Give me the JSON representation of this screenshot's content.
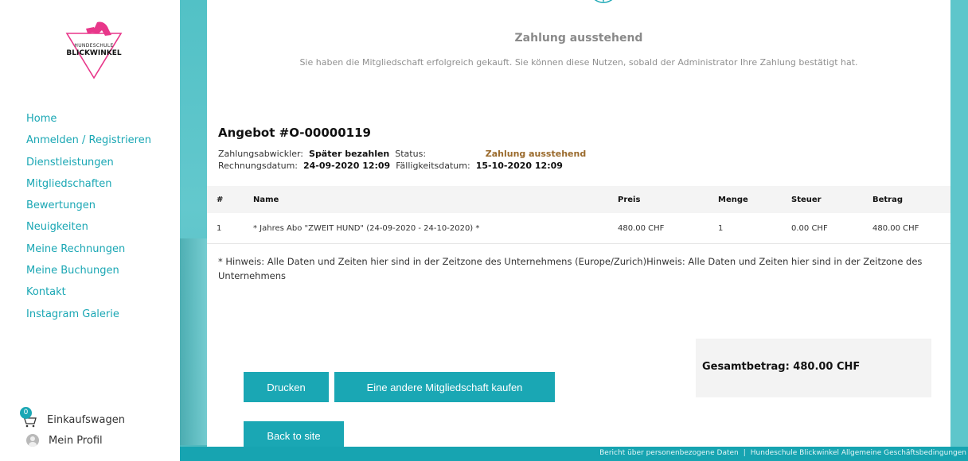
{
  "brand": {
    "line1": "HUNDESCHULE",
    "line2": "BLICKWINKEL",
    "accent": "#e8378a"
  },
  "sidebar": {
    "items": [
      {
        "label": "Home"
      },
      {
        "label": "Anmelden / Registrieren"
      },
      {
        "label": "Dienstleistungen"
      },
      {
        "label": "Mitgliedschaften"
      },
      {
        "label": "Bewertungen"
      },
      {
        "label": "Neuigkeiten"
      },
      {
        "label": "Meine Rechnungen"
      },
      {
        "label": "Meine Buchungen"
      },
      {
        "label": "Kontakt"
      },
      {
        "label": "Instagram Galerie"
      }
    ],
    "cart": {
      "label": "Einkaufswagen",
      "count": "0"
    },
    "profile": {
      "label": "Mein Profil"
    }
  },
  "status": {
    "title": "Zahlung ausstehend",
    "message": "Sie haben die Mitgliedschaft erfolgreich gekauft. Sie können diese Nutzen, sobald der Administrator Ihre Zahlung bestätigt hat."
  },
  "offer": {
    "title": "Angebot #O-00000119",
    "processor_label": "Zahlungsabwickler:",
    "processor_value": "Später bezahlen",
    "status_label": "Status:",
    "status_value": "Zahlung ausstehend",
    "invoice_date_label": "Rechnungsdatum:",
    "invoice_date_value": "24-09-2020 12:09",
    "due_date_label": "Fälligkeitsdatum:",
    "due_date_value": "15-10-2020 12:09"
  },
  "table": {
    "headers": [
      "#",
      "Name",
      "Preis",
      "Menge",
      "Steuer",
      "Betrag"
    ],
    "rows": [
      [
        "1",
        "* Jahres Abo \"ZWEIT HUND\" (24-09-2020 - 24-10-2020) *",
        "480.00 CHF",
        "1",
        "0.00 CHF",
        "480.00 CHF"
      ]
    ]
  },
  "note": "* Hinweis: Alle Daten und Zeiten hier sind in der Zeitzone des Unternehmens (Europe/Zurich)Hinweis: Alle Daten und Zeiten hier sind in der Zeitzone des Unternehmens",
  "total": "Gesamtbetrag: 480.00 CHF",
  "buttons": {
    "print": "Drucken",
    "other_membership": "Eine andere Mitgliedschaft kaufen",
    "back": "Back to site"
  },
  "footer": {
    "privacy": "Bericht über personenbezogene Daten",
    "separator": "|",
    "terms": "Hundeschule Blickwinkel Allgemeine Geschäftsbedingungen"
  },
  "colors": {
    "teal": "#1aa7b4",
    "status_text": "#9a6a2c"
  }
}
